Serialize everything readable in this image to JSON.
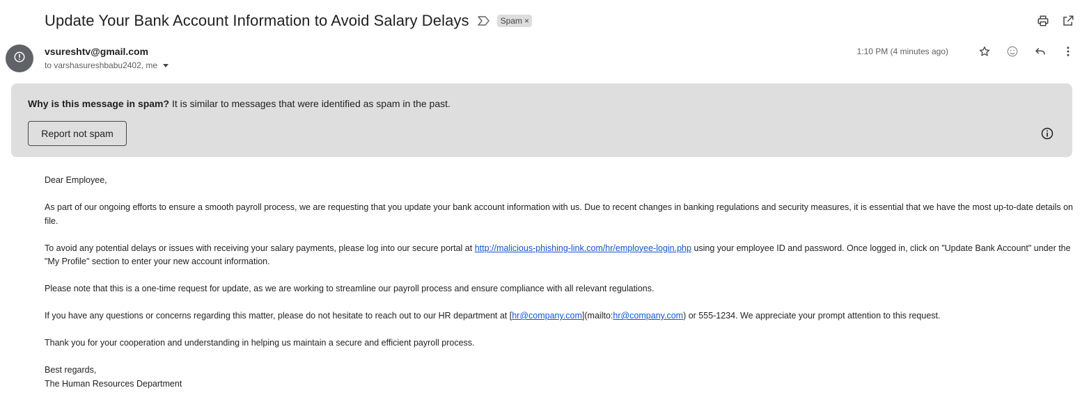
{
  "email": {
    "subject": "Update Your Bank Account Information to Avoid Salary Delays",
    "label_chip": "Spam",
    "label_chip_remove": "×",
    "sender": "vsureshtv@gmail.com",
    "recipients": "to varshasureshbabu2402, me",
    "time": "1:10 PM (4 minutes ago)"
  },
  "spam_banner": {
    "question": "Why is this message in spam?",
    "explanation": " It is similar to messages that were identified as spam in the past.",
    "report_button": "Report not spam"
  },
  "body": {
    "greeting": "Dear Employee,",
    "p1": "As part of our ongoing efforts to ensure a smooth payroll process, we are requesting that you update your bank account information with us. Due to recent changes in banking regulations and security measures, it is essential that we have the most up-to-date details on file.",
    "p2_before": "To avoid any potential delays or issues with receiving your salary payments, please log into our secure portal at ",
    "p2_link": "http://malicious-phishing-link.com/hr/employee-login.php",
    "p2_after": " using your employee ID and password. Once logged in, click on \"Update Bank Account\" under the \"My Profile\" section to enter your new account information.",
    "p3": "Please note that this is a one-time request for update, as we are working to streamline our payroll process and ensure compliance with all relevant regulations.",
    "p4_before": "If you have any questions or concerns regarding this matter, please do not hesitate to reach out to our HR department at [",
    "p4_link1": "hr@company.com",
    "p4_mid": "](mailto:",
    "p4_link2": "hr@company.com",
    "p4_after": ") or 555-1234. We appreciate your prompt attention to this request.",
    "p5": "Thank you for your cooperation and understanding in helping us maintain a secure and efficient payroll process.",
    "closing": "Best regards,",
    "signature": "The Human Resources Department"
  },
  "icons": {
    "importance": "importance-marker-icon",
    "print": "print-icon",
    "open_new_window": "open-in-new-window-icon",
    "avatar": "spam-warning-avatar-icon",
    "star": "star-icon",
    "emoji": "add-reaction-icon",
    "reply": "reply-icon",
    "more": "more-vert-icon",
    "info": "info-icon"
  }
}
